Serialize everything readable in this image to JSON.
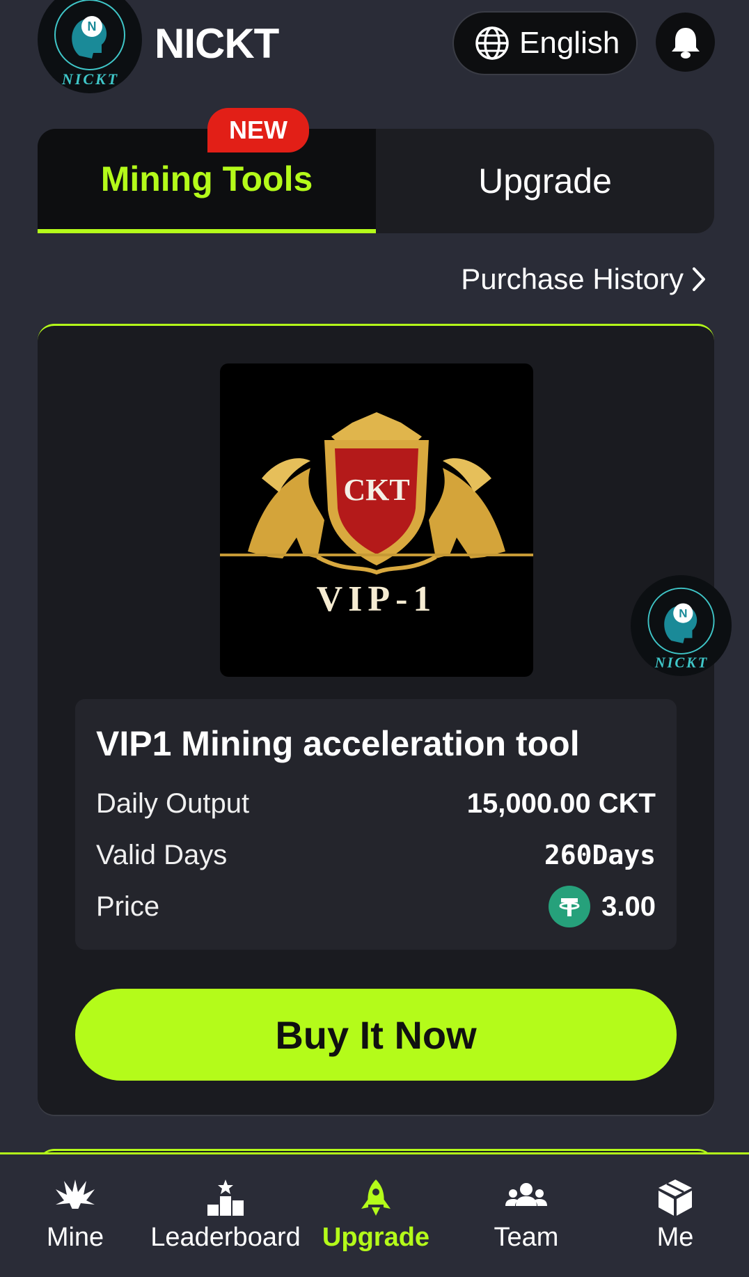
{
  "header": {
    "brand": "NICKT",
    "logo_text": "NICKT",
    "language_label": "English"
  },
  "tabs": [
    {
      "label": "Mining Tools",
      "active": true,
      "badge": "NEW"
    },
    {
      "label": "Upgrade",
      "active": false
    }
  ],
  "purchase_history_label": "Purchase History",
  "product": {
    "image_text_top": "CKT",
    "image_text_bottom": "VIP-1",
    "title": "VIP1 Mining acceleration tool",
    "rows": [
      {
        "key": "Daily Output",
        "value": "15,000.00 CKT"
      },
      {
        "key": "Valid Days",
        "value": "260Days"
      },
      {
        "key": "Price",
        "value": "3.00"
      }
    ],
    "buy_label": "Buy It Now"
  },
  "bottom_nav": [
    {
      "label": "Mine",
      "icon": "mine-icon",
      "active": false
    },
    {
      "label": "Leaderboard",
      "icon": "leaderboard-icon",
      "active": false
    },
    {
      "label": "Upgrade",
      "icon": "rocket-icon",
      "active": true
    },
    {
      "label": "Team",
      "icon": "team-icon",
      "active": false
    },
    {
      "label": "Me",
      "icon": "cube-icon",
      "active": false
    }
  ],
  "colors": {
    "background": "#2a2c37",
    "accent": "#b4fb1a",
    "badge_red": "#e21f17",
    "usdt_green": "#26a17b"
  }
}
